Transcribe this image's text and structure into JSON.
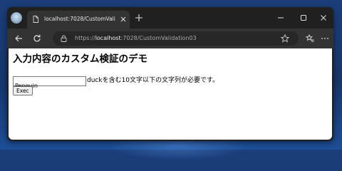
{
  "browser": {
    "tab": {
      "title": "localhost:7028/CustomValidation03"
    },
    "address": {
      "scheme": "https://",
      "host": "localhost",
      "path": ":7028/CustomValidation03"
    },
    "icons": {
      "profile": "profile-avatar-icon",
      "tab_page": "page-icon",
      "tab_close": "close-icon",
      "new_tab": "plus-icon",
      "minimize": "minimize-icon",
      "maximize": "maximize-icon",
      "close_window": "close-icon",
      "back": "back-arrow-icon",
      "refresh": "refresh-icon",
      "lock": "lock-icon",
      "favorite": "star-icon",
      "favorites_list": "favorites-icon",
      "menu": "more-icon"
    },
    "colors": {
      "frame": "#202020",
      "toolbar": "#333333",
      "address_bar": "#272727",
      "desktop": "#1b3e7a"
    }
  },
  "page": {
    "heading": "入力内容のカスタム検証のデモ",
    "input": {
      "value": "Penguin"
    },
    "hint": "duckを含む10文字以下の文字列が必要です。",
    "button_label": "Exec"
  }
}
